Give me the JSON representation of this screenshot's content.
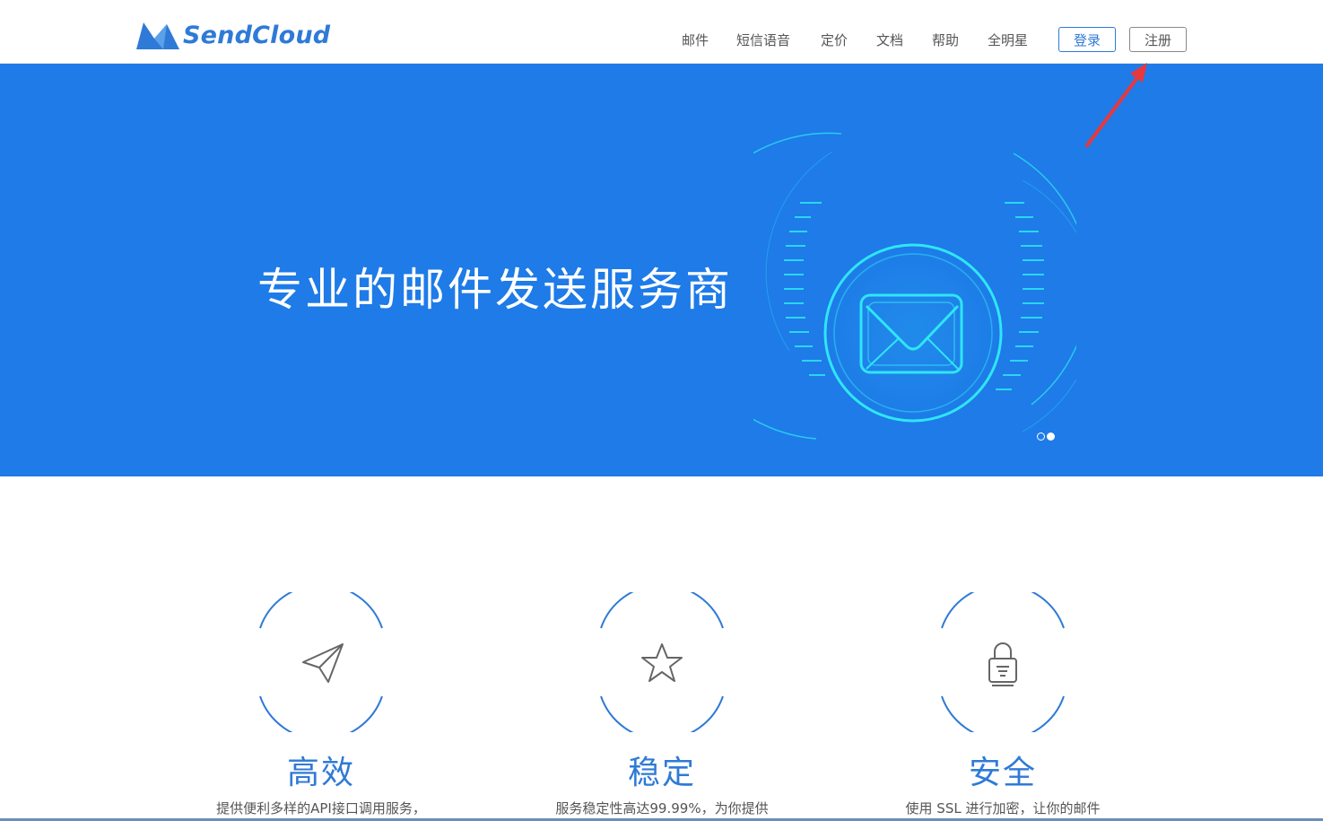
{
  "header": {
    "logo_text": "SendCloud",
    "nav": [
      {
        "label": "邮件"
      },
      {
        "label": "短信语音"
      },
      {
        "label": "定价"
      },
      {
        "label": "文档"
      },
      {
        "label": "帮助"
      },
      {
        "label": "全明星"
      }
    ],
    "login_label": "登录",
    "register_label": "注册"
  },
  "hero": {
    "title": "专业的邮件发送服务商",
    "carousel_active_index": 2,
    "carousel_count": 2,
    "graphic_icon": "envelope-icon"
  },
  "features": [
    {
      "icon": "paper-plane-icon",
      "title": "高效",
      "desc": "提供便利多样的API接口调用服务，"
    },
    {
      "icon": "star-icon",
      "title": "稳定",
      "desc": "服务稳定性高达99.99%，为你提供"
    },
    {
      "icon": "lock-icon",
      "title": "安全",
      "desc": "使用 SSL 进行加密，让你的邮件"
    }
  ],
  "colors": {
    "brand": "#2f7ad6",
    "hero_bg": "#1e7be8",
    "accent_cyan": "#2ee6f6",
    "annotation_arrow": "#e8383d"
  }
}
